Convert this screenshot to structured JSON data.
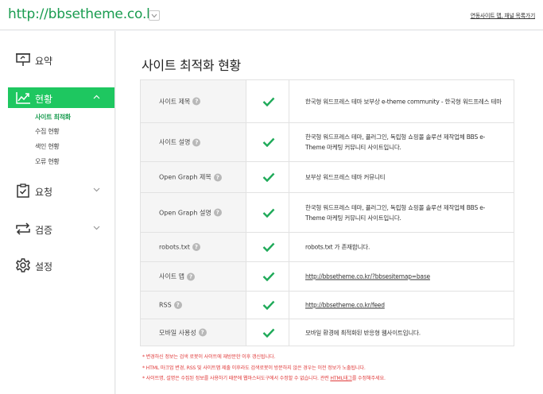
{
  "header": {
    "site_url": "http://bbsetheme.co.kr",
    "site_list_link": "연동사이트 맵, 채널 목록가기"
  },
  "sidebar": {
    "items": [
      {
        "label": "요약",
        "icon": "presentation-icon"
      },
      {
        "label": "현황",
        "icon": "trend-chart-icon",
        "active": true
      },
      {
        "label": "요청",
        "icon": "clipboard-check-icon"
      },
      {
        "label": "검증",
        "icon": "sync-arrows-icon"
      },
      {
        "label": "설정",
        "icon": "gear-icon"
      }
    ],
    "subitems": [
      {
        "label": "사이트 최적화",
        "active": true
      },
      {
        "label": "수집 현황"
      },
      {
        "label": "색인 현황"
      },
      {
        "label": "오류 현황"
      }
    ]
  },
  "main": {
    "title": "사이트 최적화 현황",
    "rows": [
      {
        "label": "사이트 제목",
        "value": "한국형 워드프레스 테마 보부상 e-theme community - 한국형 워드프레스 테마"
      },
      {
        "label": "사이트 설명",
        "value": "한국형 워드프레스 테마, 플러그인, 독립형 쇼핑몰 솔루션 제작업체 BBS e-Theme 마케팅 커뮤니티 사이트입니다."
      },
      {
        "label": "Open Graph 제목",
        "value": "보부상 워드프레스 테마 커뮤니티"
      },
      {
        "label": "Open Graph 설명",
        "value": "한국형 워드프레스 테마, 플러그인, 독립형 쇼핑몰 솔루션 제작업체 BBS e-Theme 마케팅 커뮤니티 사이트입니다."
      },
      {
        "label": "robots.txt",
        "value": "robots.txt 가 존재합니다."
      },
      {
        "label": "사이트 맵",
        "value": "http://bbsetheme.co.kr/?bbsesitemap=base"
      },
      {
        "label": "RSS",
        "value": "http://bbsetheme.co.kr/feed"
      },
      {
        "label": "모바일 사용성",
        "value": "모바일 환경에 최적화된 반응형 웹사이트입니다."
      }
    ],
    "help_glyph": "?",
    "notes": [
      "* 변경하신 정보는 검색 로봇이 사이트에 재방문한 이후 갱신됩니다.",
      "* HTML 마크업 변경, RSS 및 사이트맵 제출 이후라도 검색로봇이 방문하지 않은 경우는 이전 정보가 노출됩니다.",
      "* 사이트명, 설명은 수집된 정보를 사용하기 때문에 웹마스터도구에서 수정할 수 없습니다. 관련 HTML태그를 수정해주세요."
    ],
    "note_link": "HTML태그"
  },
  "colors": {
    "brand_green": "#1a9c50",
    "active_nav": "#1ec760",
    "check_green": "#1faa59",
    "note_red": "#e03b3b"
  }
}
